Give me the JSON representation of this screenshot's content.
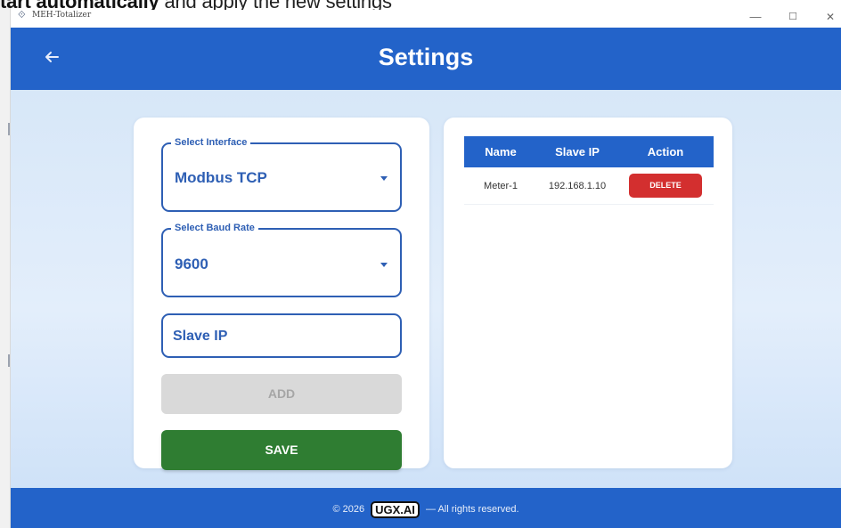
{
  "overlay": {
    "strike_text": "tart automatically",
    "rest_text": " and apply the new settings"
  },
  "window": {
    "app_title": "MEH-Totalizer",
    "minimize": "—",
    "maximize": "☐",
    "close": "✕"
  },
  "header": {
    "title": "Settings",
    "back_icon": "arrow-left-icon"
  },
  "form": {
    "interface": {
      "legend": "Select Interface",
      "value": "Modbus TCP"
    },
    "baud_rate": {
      "legend": "Select Baud Rate",
      "value": "9600"
    },
    "slave_ip": {
      "placeholder": "Slave IP",
      "value": ""
    },
    "add_label": "ADD",
    "save_label": "SAVE"
  },
  "table": {
    "headers": [
      "Name",
      "Slave IP",
      "Action"
    ],
    "rows": [
      {
        "name": "Meter-1",
        "slave_ip": "192.168.1.10",
        "action": "DELETE"
      }
    ]
  },
  "footer": {
    "prefix": "© 2026",
    "logo": "UGX.AI",
    "suffix": "— All rights reserved."
  },
  "colors": {
    "primary": "#2363c9",
    "field_accent": "#2e5fb4",
    "save": "#2f7d32",
    "delete": "#d32f2f",
    "disabled": "#d9d9d9"
  }
}
